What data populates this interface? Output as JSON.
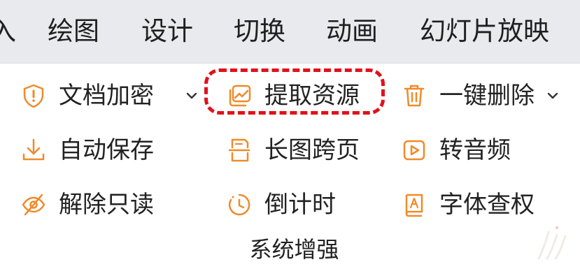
{
  "menubar": {
    "cut_tab": "入",
    "tabs": [
      {
        "label": "绘图"
      },
      {
        "label": "设计"
      },
      {
        "label": "切换"
      },
      {
        "label": "动画"
      },
      {
        "label": "幻灯片放映"
      }
    ]
  },
  "items": {
    "encrypt": {
      "label": "文档加密",
      "icon": "shield-exclamation-icon"
    },
    "extract": {
      "label": "提取资源",
      "icon": "image-stack-icon"
    },
    "delete": {
      "label": "一键删除",
      "icon": "trash-icon"
    },
    "autosave": {
      "label": "自动保存",
      "icon": "download-icon"
    },
    "longimage": {
      "label": "长图跨页",
      "icon": "long-image-icon"
    },
    "audio": {
      "label": "转音频",
      "icon": "play-box-icon"
    },
    "readonly": {
      "label": "解除只读",
      "icon": "eye-off-icon"
    },
    "countdown": {
      "label": "倒计时",
      "icon": "timer-icon"
    },
    "font": {
      "label": "字体查权",
      "icon": "font-book-icon"
    }
  },
  "group": {
    "label": "系统增强"
  },
  "colors": {
    "icon_orange": "#f08a2a",
    "highlight_red": "#e0111b",
    "menubar_bg": "#e9eaed"
  }
}
